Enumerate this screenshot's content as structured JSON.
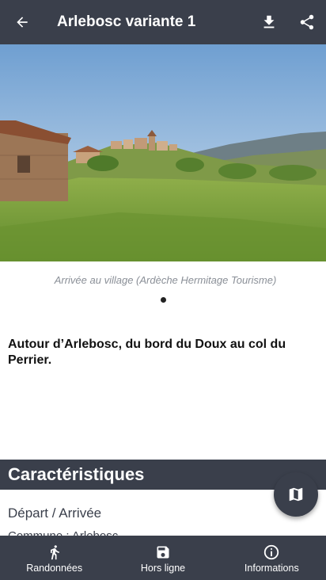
{
  "appbar": {
    "title": "Arlebosc variante 1",
    "back_icon": "arrow-back-icon",
    "download_icon": "download-icon",
    "share_icon": "share-icon"
  },
  "hero": {
    "caption": "Arrivée au village (Ardèche Hermitage Tourisme)",
    "page_indicator": {
      "count": 1,
      "active": 1
    }
  },
  "summary": "Autour d’Arlebosc, du bord du Doux au col du Perrier.",
  "characteristics": {
    "title": "Caractéristiques",
    "depart_label": "Départ / Arrivée",
    "commune": "Commune : Arlebosc"
  },
  "fab": {
    "icon": "map-icon"
  },
  "bottom_nav": {
    "items": [
      {
        "label": "Randonnées",
        "icon": "hiker-icon"
      },
      {
        "label": "Hors ligne",
        "icon": "save-icon"
      },
      {
        "label": "Informations",
        "icon": "info-icon"
      }
    ]
  },
  "colors": {
    "bar": "#3a3f4b",
    "text_on_bar": "#ffffff",
    "caption": "#8a8f97"
  }
}
